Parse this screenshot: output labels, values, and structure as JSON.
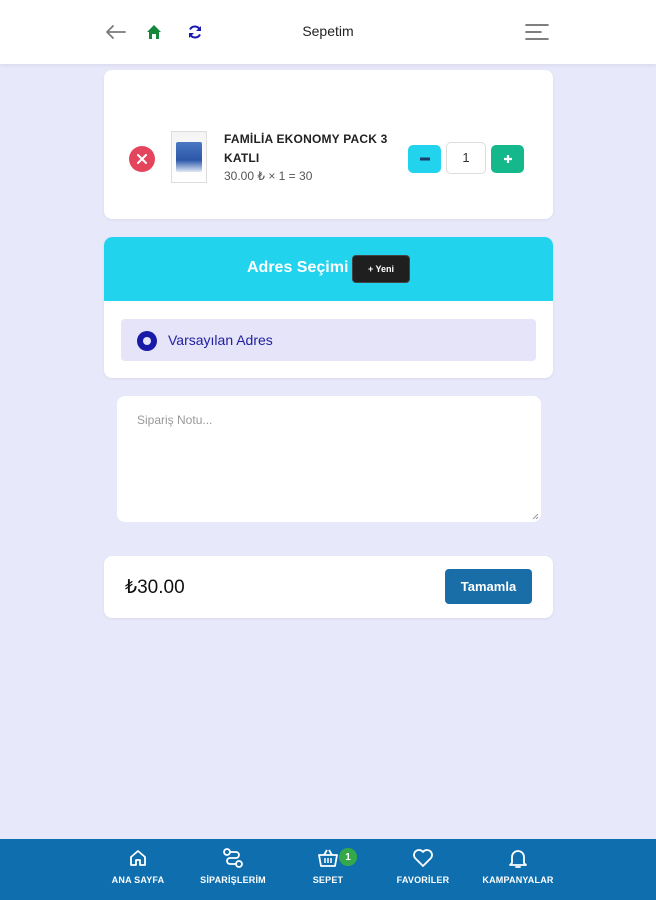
{
  "header": {
    "title": "Sepetim",
    "icons": {
      "back": "back-arrow-icon",
      "home": "home-icon",
      "refresh": "refresh-icon",
      "menu": "menu-icon"
    }
  },
  "cart": {
    "items": [
      {
        "name": "FAMİLİA EKONOMY PACK 3 KATLI",
        "price_line": "30.00 ₺ × 1 = 30",
        "quantity": "1",
        "minus_label": "−",
        "plus_label": "+"
      }
    ]
  },
  "address": {
    "title": "Adres Seçimi",
    "new_button": "+ Yeni",
    "options": [
      {
        "label": "Varsayılan Adres",
        "selected": true
      }
    ]
  },
  "note": {
    "placeholder": "Sipariş Notu..."
  },
  "total": {
    "amount": "₺30.00",
    "complete_label": "Tamamla"
  },
  "bottom_nav": {
    "items": [
      {
        "label": "ANA SAYFA",
        "icon": "home-icon"
      },
      {
        "label": "SİPARİŞLERİM",
        "icon": "route-icon"
      },
      {
        "label": "SEPET",
        "icon": "basket-icon",
        "badge": "1"
      },
      {
        "label": "FAVORİLER",
        "icon": "heart-icon"
      },
      {
        "label": "KAMPANYALAR",
        "icon": "bell-icon"
      }
    ]
  },
  "colors": {
    "background": "#e8e8fb",
    "accent_cyan": "#22d3ee",
    "remove_red": "#e5455c",
    "plus_green": "#15b88a",
    "primary_blue": "#1a6ea8",
    "nav_blue": "#0f6fae",
    "radio_blue": "#1a1aa8"
  }
}
